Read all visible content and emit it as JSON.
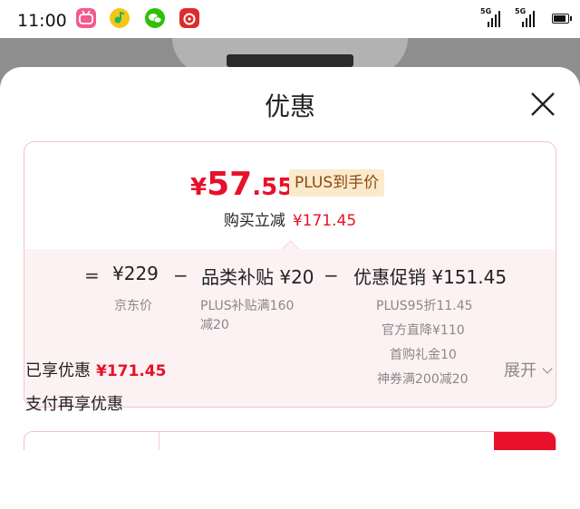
{
  "status_bar": {
    "time": "11:00",
    "apps": [
      {
        "icon": "bilibili-icon",
        "color": "#f35b8c"
      },
      {
        "icon": "qq-music-icon",
        "color": "#f5c518"
      },
      {
        "icon": "wechat-icon",
        "color": "#2dc100"
      },
      {
        "icon": "netease-music-icon",
        "color": "#dd2c2c"
      }
    ],
    "signal_label": "5G"
  },
  "sheet": {
    "title": "优惠",
    "close_icon": "close-icon"
  },
  "summary": {
    "price_yen": "¥",
    "price_int": "57",
    "price_dec": ".55",
    "badge": "PLUS到手价",
    "savings_label": "购买立减",
    "savings_amount": "¥171.45"
  },
  "breakdown": {
    "equals": "=",
    "base_price": "¥229",
    "base_label": "京东价",
    "minus": "−",
    "category_subsidy": "品类补贴 ¥20",
    "category_detail": [
      "PLUS补贴满160",
      "减20"
    ],
    "promo": "优惠促销 ¥151.45",
    "promo_details": [
      "PLUS95折11.45",
      "官方直降¥110",
      "首购礼金10",
      "神券满200减20"
    ]
  },
  "enjoyed": {
    "label": "已享优惠",
    "amount": "¥171.45",
    "expand": "展开"
  },
  "pay_more": "支付再享优惠",
  "colors": {
    "accent_red": "#e8102a",
    "badge_bg": "#fbeacb",
    "card_border": "#f4c2c8"
  }
}
